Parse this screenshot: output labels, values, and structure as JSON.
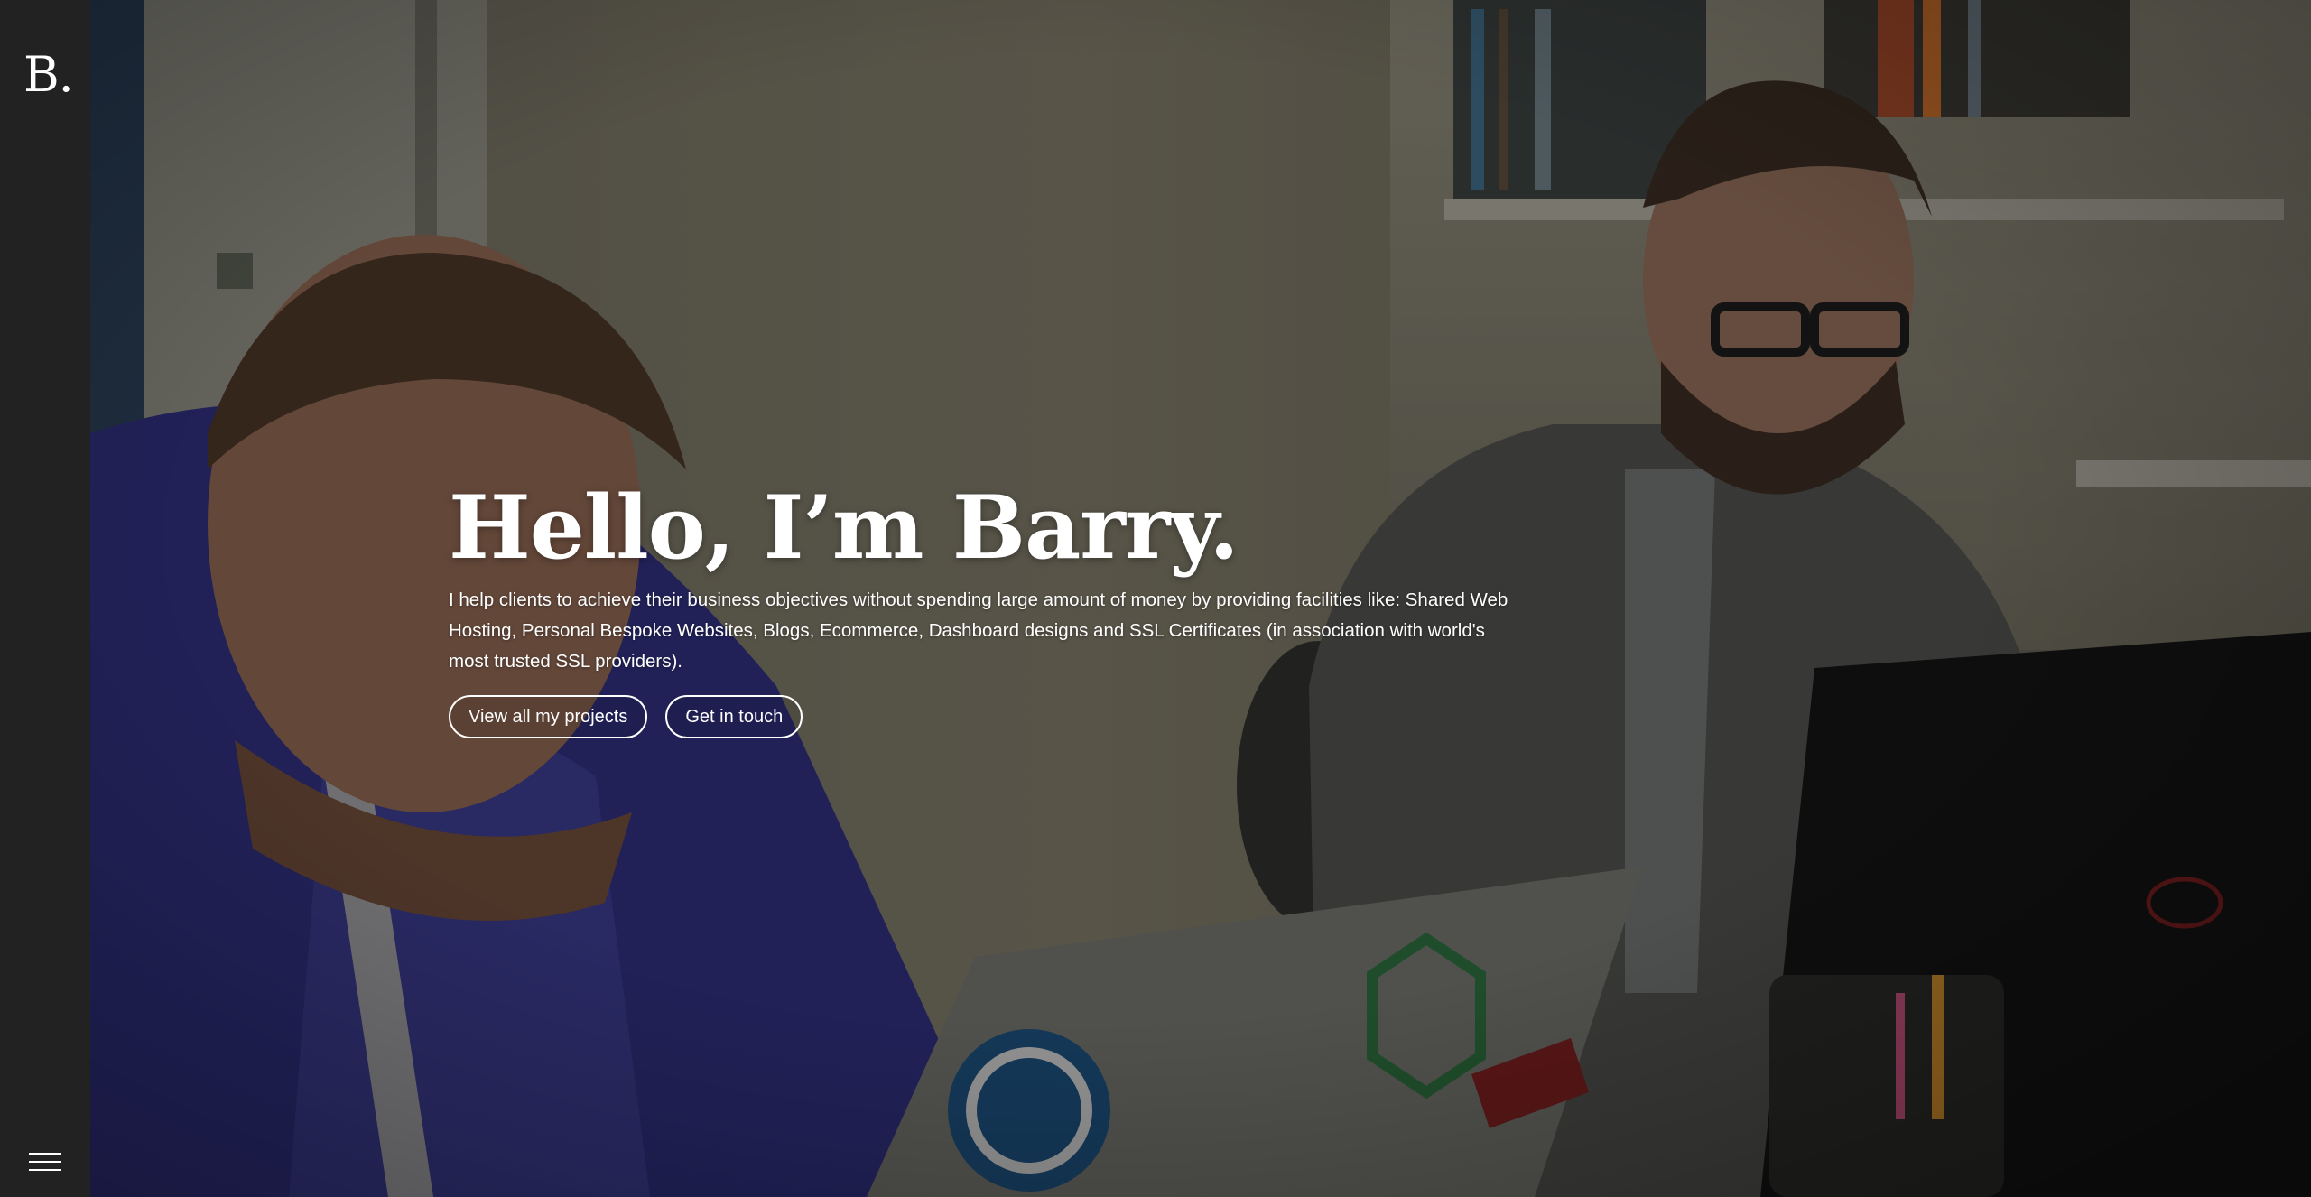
{
  "sidebar": {
    "logo": "B.",
    "menu_icon": "hamburger-menu-icon"
  },
  "hero": {
    "title": "Hello, I’m Barry.",
    "description": "I help clients to achieve their business objectives without spending large amount of money by providing facilities like: Shared Web Hosting, Personal Bespoke Websites, Blogs, Ecommerce, Dashboard designs and SSL Certificates (in association with world's most trusted SSL providers).",
    "buttons": {
      "projects": "View all my projects",
      "contact": "Get in touch"
    }
  },
  "colors": {
    "sidebar_bg": "#222222",
    "text": "#ffffff"
  }
}
